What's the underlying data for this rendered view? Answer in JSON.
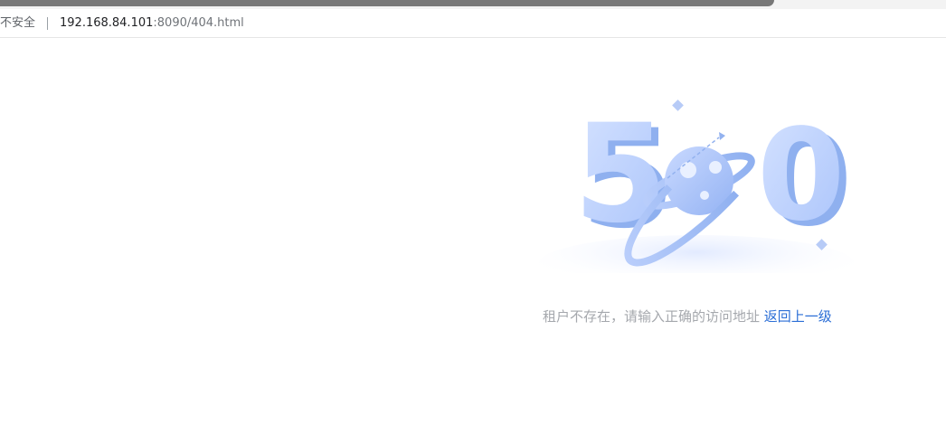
{
  "browser": {
    "security_label": "不安全",
    "url_host": "192.168.84.101",
    "url_rest": ":8090/404.html"
  },
  "error_page": {
    "code": "500",
    "digit_left": "5",
    "digit_right": "0",
    "message": "租户不存在，请输入正确的访问地址",
    "back_link": "返回上一级",
    "accent_color": "#2b6ed6"
  }
}
